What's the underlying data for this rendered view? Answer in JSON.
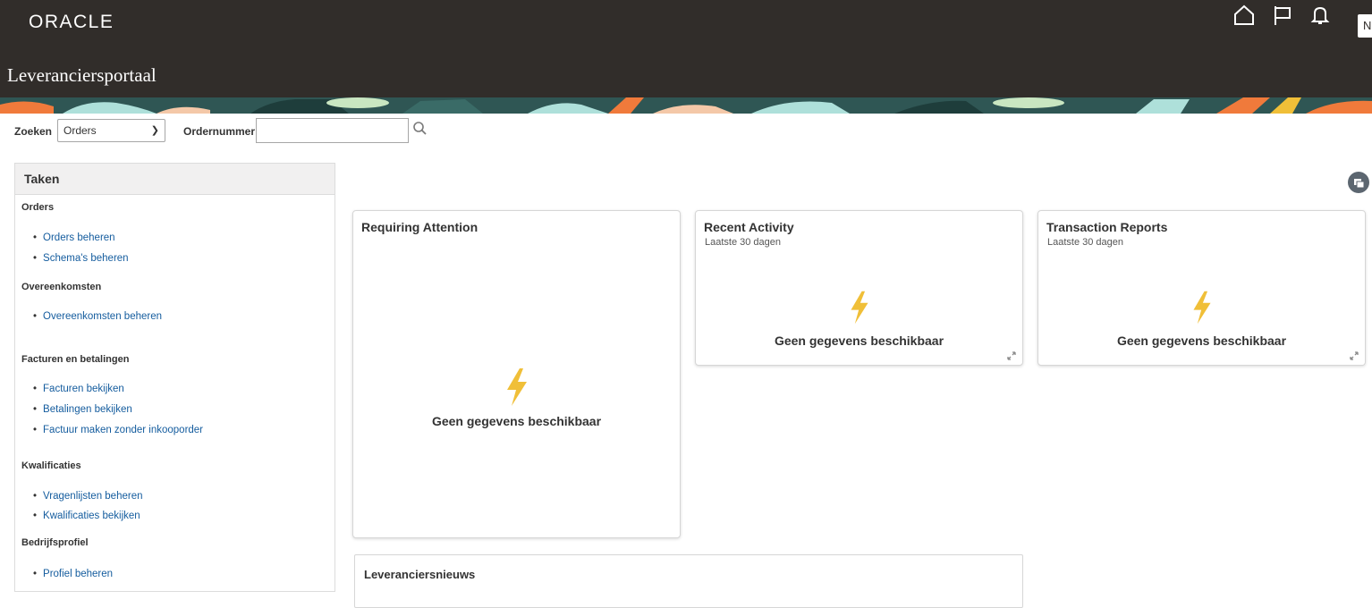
{
  "header": {
    "logo": "ORACLE",
    "title": "Leveranciersportaal",
    "avatar_initial": "N",
    "icons": [
      "home-icon",
      "flag-icon",
      "bell-icon"
    ]
  },
  "search": {
    "label": "Zoeken",
    "select_value": "Orders",
    "field_label": "Ordernummer",
    "field_value": ""
  },
  "tasks": {
    "title": "Taken",
    "groups": [
      {
        "name": "Orders",
        "items": [
          "Orders beheren",
          "Schema's beheren"
        ]
      },
      {
        "name": "Overeenkomsten",
        "items": [
          "Overeenkomsten beheren"
        ]
      },
      {
        "name": "Facturen en betalingen",
        "items": [
          "Facturen bekijken",
          "Betalingen bekijken",
          "Factuur maken zonder inkooporder"
        ]
      },
      {
        "name": "Kwalificaties",
        "items": [
          "Vragenlijsten beheren",
          "Kwalificaties bekijken"
        ]
      },
      {
        "name": "Bedrijfsprofiel",
        "items": [
          "Profiel beheren"
        ]
      }
    ]
  },
  "cards": {
    "attention": {
      "title": "Requiring Attention",
      "empty": "Geen gegevens beschikbaar"
    },
    "recent": {
      "title": "Recent Activity",
      "subtitle": "Laatste 30 dagen",
      "empty": "Geen gegevens beschikbaar"
    },
    "reports": {
      "title": "Transaction Reports",
      "subtitle": "Laatste 30 dagen",
      "empty": "Geen gegevens beschikbaar"
    },
    "news": {
      "title": "Leveranciersnieuws"
    }
  },
  "colors": {
    "header_bg": "#312d2a",
    "link": "#145c9e",
    "bolt": "#f0bf38"
  }
}
